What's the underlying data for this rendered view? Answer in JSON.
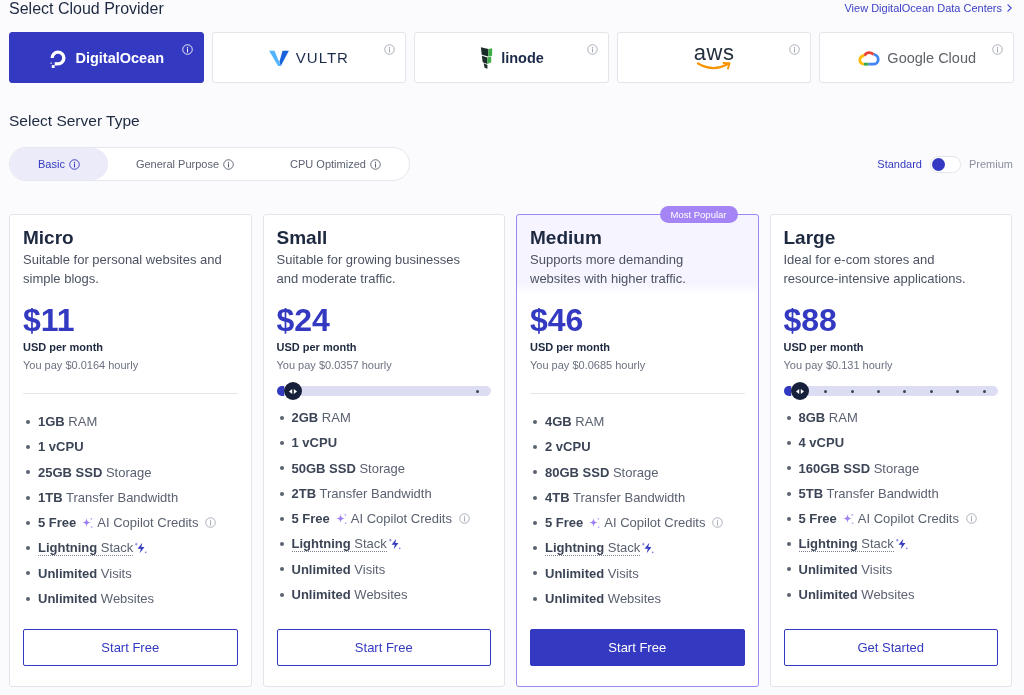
{
  "header": {
    "title": "Select Cloud Provider",
    "link": "View DigitalOcean Data Centers"
  },
  "providers": [
    {
      "kind": "ring",
      "name": "DigitalOcean",
      "selected": true
    },
    {
      "kind": "chevron",
      "name": "VULTR",
      "selected": false
    },
    {
      "kind": "blocks",
      "name": "linode",
      "selected": false
    },
    {
      "kind": "smile",
      "name": "aws",
      "selected": false
    },
    {
      "kind": "cloud",
      "name": "Google Cloud",
      "selected": false
    }
  ],
  "server_type": {
    "title": "Select Server Type",
    "tabs": [
      {
        "label": "Basic",
        "selected": true
      },
      {
        "label": "General Purpose",
        "selected": false
      },
      {
        "label": "CPU Optimized",
        "selected": false
      }
    ],
    "tier_toggle": {
      "options": [
        {
          "label": "Standard",
          "selected": true
        },
        {
          "label": "Premium",
          "selected": false
        }
      ]
    }
  },
  "plans": [
    {
      "name": "Micro",
      "description": "Suitable for personal websites and simple blogs.",
      "price": "$11",
      "unit": "USD per month",
      "hourly": "You pay $0.0164 hourly",
      "highlighted": false,
      "features": [
        {
          "kind": "spec",
          "text": "**1GB** RAM"
        },
        {
          "kind": "strong",
          "text": "1 vCPU"
        },
        {
          "kind": "spec",
          "text": "**25GB SSD** Storage"
        },
        {
          "kind": "spec",
          "text": "**1TB** Transfer Bandwidth"
        },
        {
          "kind": "credits",
          "amount": "5 Free",
          "label": "AI Copilot Credits"
        },
        {
          "kind": "stack",
          "text": "**Lightning** Stack"
        },
        {
          "kind": "spec",
          "text": "**Unlimited** Visits"
        },
        {
          "kind": "spec",
          "text": "**Unlimited** Websites"
        }
      ],
      "button": {
        "label": "Start Free",
        "primary": false
      }
    },
    {
      "name": "Small",
      "description": "Suitable for growing businesses and moderate traffic.",
      "price": "$24",
      "unit": "USD per month",
      "hourly": "You pay $0.0357 hourly",
      "highlighted": false,
      "slider": {
        "stops": [
          {
            "selected": true
          },
          {
            "selected": false
          }
        ]
      },
      "features": [
        {
          "kind": "spec",
          "text": "**2GB** RAM"
        },
        {
          "kind": "strong",
          "text": "1 vCPU"
        },
        {
          "kind": "spec",
          "text": "**50GB SSD** Storage"
        },
        {
          "kind": "spec",
          "text": "**2TB** Transfer Bandwidth"
        },
        {
          "kind": "credits",
          "amount": "5 Free",
          "label": "AI Copilot Credits"
        },
        {
          "kind": "stack",
          "text": "**Lightning** Stack"
        },
        {
          "kind": "spec",
          "text": "**Unlimited** Visits"
        },
        {
          "kind": "spec",
          "text": "**Unlimited** Websites"
        }
      ],
      "button": {
        "label": "Start Free",
        "primary": false
      }
    },
    {
      "name": "Medium",
      "badge": "Most Popular",
      "description": "Supports more demanding websites with higher traffic.",
      "price": "$46",
      "unit": "USD per month",
      "hourly": "You pay $0.0685 hourly",
      "highlighted": true,
      "features": [
        {
          "kind": "spec",
          "text": "**4GB** RAM"
        },
        {
          "kind": "strong",
          "text": "2 vCPU"
        },
        {
          "kind": "spec",
          "text": "**80GB SSD** Storage"
        },
        {
          "kind": "spec",
          "text": "**4TB** Transfer Bandwidth"
        },
        {
          "kind": "credits",
          "amount": "5 Free",
          "label": "AI Copilot Credits"
        },
        {
          "kind": "stack",
          "text": "**Lightning** Stack"
        },
        {
          "kind": "spec",
          "text": "**Unlimited** Visits"
        },
        {
          "kind": "spec",
          "text": "**Unlimited** Websites"
        }
      ],
      "button": {
        "label": "Start Free",
        "primary": true
      }
    },
    {
      "name": "Large",
      "description": "Ideal for e-com stores and resource-intensive applications.",
      "price": "$88",
      "unit": "USD per month",
      "hourly": "You pay $0.131 hourly",
      "highlighted": false,
      "slider": {
        "stops": [
          {
            "selected": true
          },
          {
            "selected": false
          },
          {
            "selected": false
          },
          {
            "selected": false
          },
          {
            "selected": false
          },
          {
            "selected": false
          },
          {
            "selected": false
          },
          {
            "selected": false
          }
        ]
      },
      "features": [
        {
          "kind": "spec",
          "text": "**8GB** RAM"
        },
        {
          "kind": "strong",
          "text": "4 vCPU"
        },
        {
          "kind": "spec",
          "text": "**160GB SSD** Storage"
        },
        {
          "kind": "spec",
          "text": "**5TB** Transfer Bandwidth"
        },
        {
          "kind": "credits",
          "amount": "5 Free",
          "label": "AI Copilot Credits"
        },
        {
          "kind": "stack",
          "text": "**Lightning** Stack"
        },
        {
          "kind": "spec",
          "text": "**Unlimited** Visits"
        },
        {
          "kind": "spec",
          "text": "**Unlimited** Websites"
        }
      ],
      "button": {
        "label": "Get Started",
        "primary": false
      }
    }
  ]
}
